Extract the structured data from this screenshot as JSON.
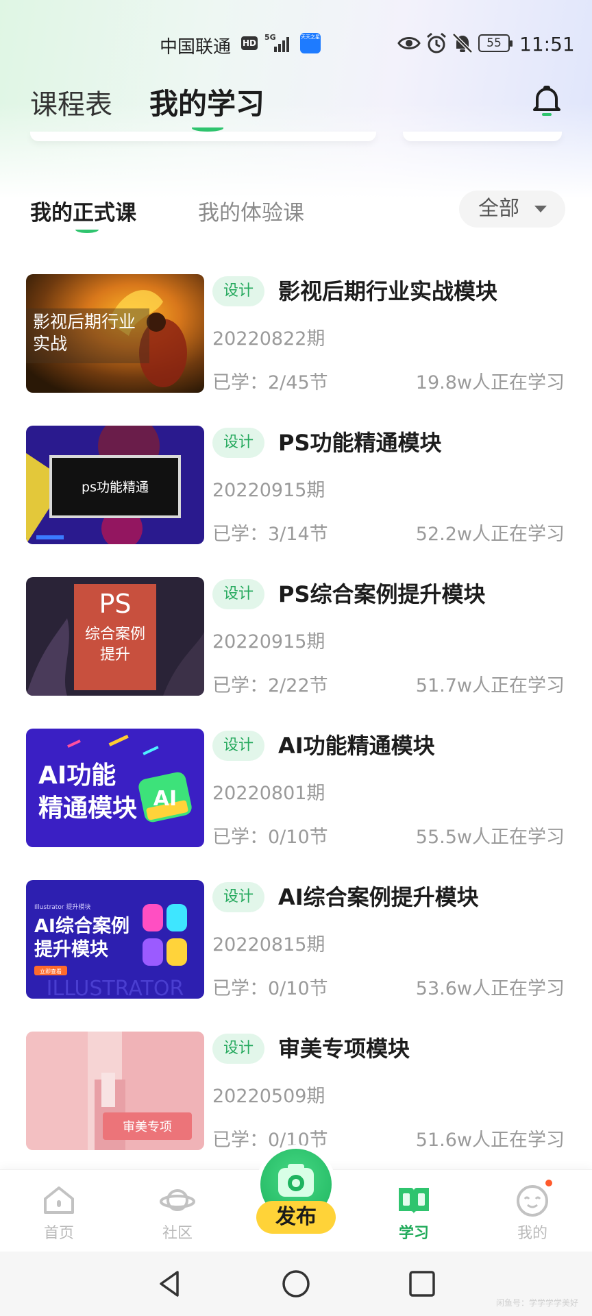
{
  "status_bar": {
    "carrier": "中国联通",
    "hd": "HD",
    "network": "5G",
    "app_badge": "天天之星",
    "battery": "55",
    "time": "11:51"
  },
  "header": {
    "tabs": [
      {
        "label": "课程表",
        "active": false
      },
      {
        "label": "我的学习",
        "active": true
      }
    ],
    "notification_icon": "bell-icon"
  },
  "sub_tabs": [
    {
      "label": "我的正式课",
      "active": true
    },
    {
      "label": "我的体验课",
      "active": false
    }
  ],
  "filter": {
    "label": "全部"
  },
  "courses": [
    {
      "tag": "设计",
      "title": "影视后期行业实战模块",
      "period": "20220822期",
      "progress": "已学：2/45节",
      "learners": "19.8w人正在学习",
      "thumb_text": [
        "影视后期行业",
        "实战"
      ]
    },
    {
      "tag": "设计",
      "title": "PS功能精通模块",
      "period": "20220915期",
      "progress": "已学：3/14节",
      "learners": "52.2w人正在学习",
      "thumb_text": [
        "ps功能精通"
      ]
    },
    {
      "tag": "设计",
      "title": "PS综合案例提升模块",
      "period": "20220915期",
      "progress": "已学：2/22节",
      "learners": "51.7w人正在学习",
      "thumb_text": [
        "PS",
        "综合案例",
        "提升"
      ]
    },
    {
      "tag": "设计",
      "title": "AI功能精通模块",
      "period": "20220801期",
      "progress": "已学：0/10节",
      "learners": "55.5w人正在学习",
      "thumb_text": [
        "AI功能",
        "精通模块",
        "AI"
      ]
    },
    {
      "tag": "设计",
      "title": "AI综合案例提升模块",
      "period": "20220815期",
      "progress": "已学：0/10节",
      "learners": "53.6w人正在学习",
      "thumb_text": [
        "Illustrator 提升模块",
        "AI综合案例",
        "提升模块",
        "立即查看",
        "ILLUSTRATOR"
      ]
    },
    {
      "tag": "设计",
      "title": "审美专项模块",
      "period": "20220509期",
      "progress": "已学：0/10节",
      "learners": "51.6w人正在学习",
      "thumb_text": [
        "审美专项"
      ]
    }
  ],
  "bottom_nav": {
    "items": [
      {
        "label": "首页",
        "icon": "home-icon"
      },
      {
        "label": "社区",
        "icon": "planet-icon"
      },
      {
        "label": "学习",
        "icon": "book-icon",
        "active": true
      },
      {
        "label": "我的",
        "icon": "face-icon"
      }
    ],
    "publish_label": "发布"
  },
  "watermark": "闲鱼号：学学学学美好",
  "colors": {
    "accent": "#2fc46e",
    "tag_bg": "#e2f6ea",
    "publish_yellow": "#ffd338"
  }
}
